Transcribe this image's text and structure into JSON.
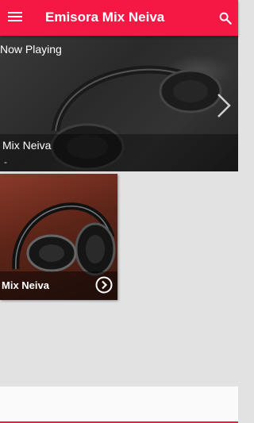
{
  "appbar": {
    "title": "Emisora Mix Neiva",
    "menu_icon": "menu-icon",
    "search_icon": "search-icon",
    "color": "#f51845"
  },
  "now_playing": {
    "heading": "Now Playing",
    "station": "Mix Neiva",
    "subtitle": "-",
    "next_icon": "chevron-right-icon"
  },
  "stations": [
    {
      "name": "Mix Neiva",
      "action_icon": "chevron-circle-right-icon"
    }
  ]
}
